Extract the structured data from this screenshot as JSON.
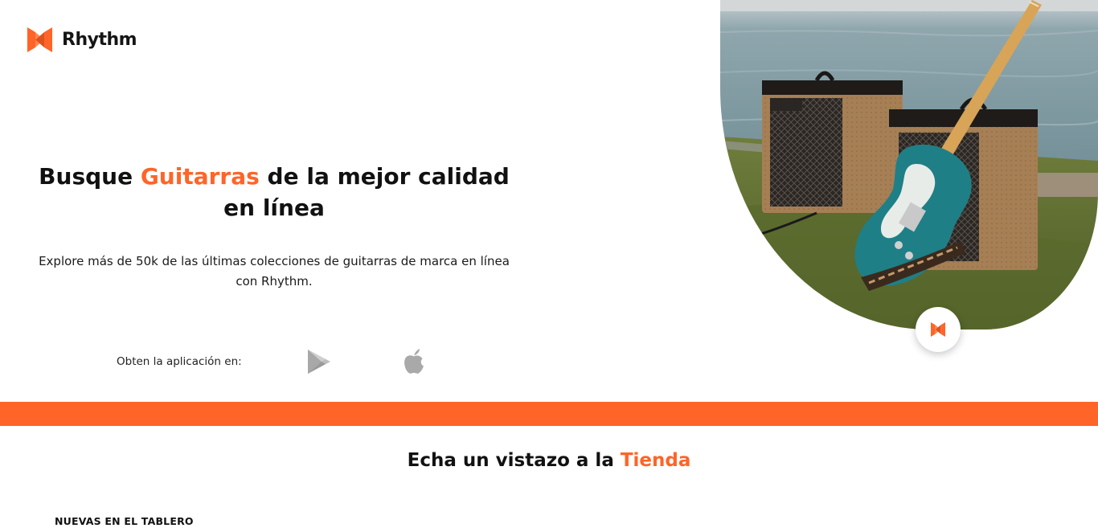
{
  "brand": {
    "name": "Rhythm",
    "accent_color": "#ff6428"
  },
  "hero": {
    "title_pre": "Busque ",
    "title_accent": "Guitarras",
    "title_post": " de la mejor calidad en línea",
    "description": "Explore más de 50k de las últimas colecciones de guitarras de marca en línea con Rhythm.",
    "get_app_label": "Obten la aplicación en:",
    "store_icons": [
      "google-play-icon",
      "apple-icon"
    ],
    "image_subject": "guitar-and-amplifiers-photo"
  },
  "shop": {
    "title_pre": "Echa un vistazo a la ",
    "title_accent": "Tienda",
    "section_label": "NUEVAS EN EL TABLERO"
  }
}
